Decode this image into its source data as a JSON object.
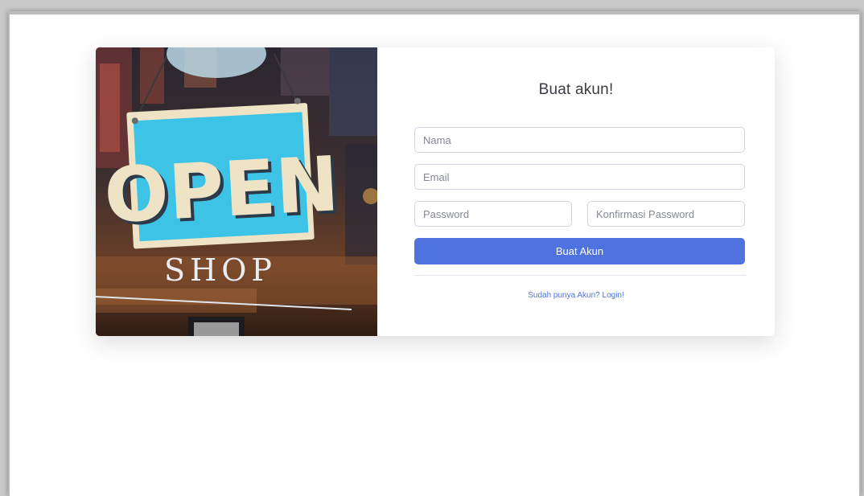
{
  "form": {
    "title": "Buat akun!",
    "name_placeholder": "Nama",
    "email_placeholder": "Email",
    "password_placeholder": "Password",
    "confirm_password_placeholder": "Konfirmasi Password",
    "submit_label": "Buat Akun",
    "login_link": "Sudah punya Akun? Login!"
  },
  "image": {
    "sign_text": "OPEN",
    "shop_text": "SHOP"
  },
  "colors": {
    "primary": "#4e73df",
    "sign_blue": "#3cc3e6",
    "sign_cream": "#efe3c6"
  }
}
